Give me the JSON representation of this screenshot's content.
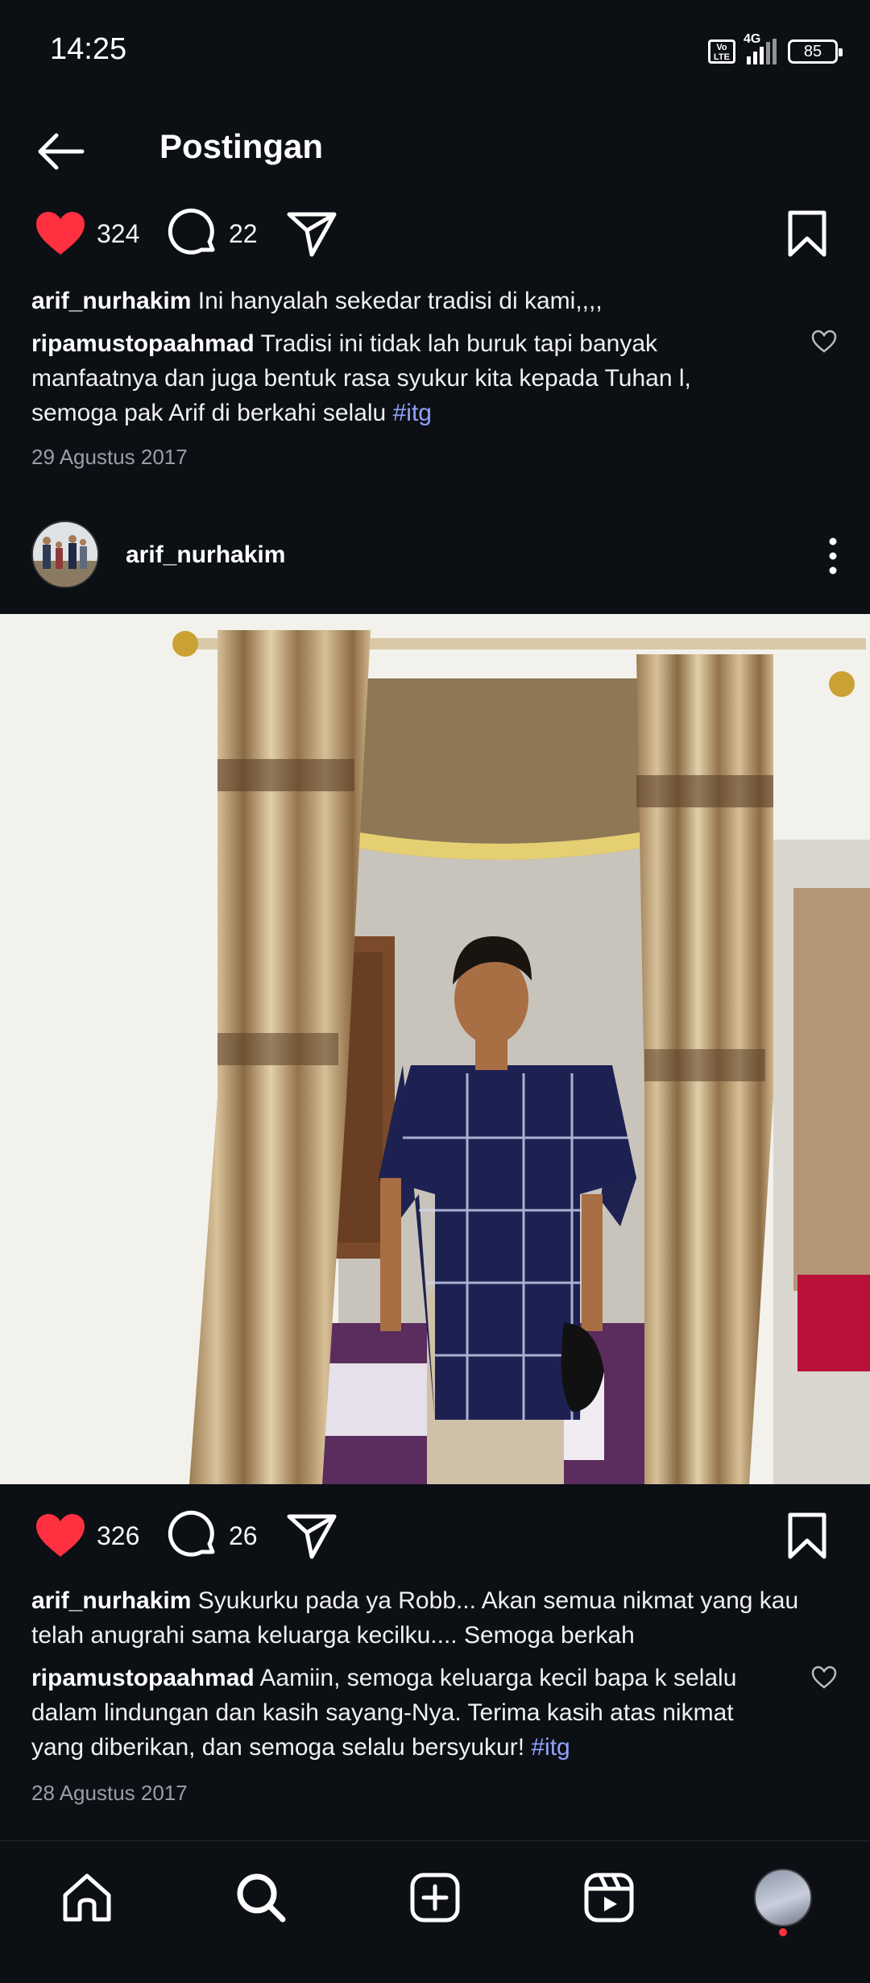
{
  "status_bar": {
    "time": "14:25",
    "volte": "Vo LTE",
    "network": "4G",
    "battery": "85"
  },
  "header": {
    "title": "Postingan"
  },
  "post1": {
    "likes": "324",
    "comments": "22",
    "caption_user": "arif_nurhakim",
    "caption_text": " Ini hanyalah sekedar tradisi di kami,,,,",
    "comment_user": "ripamustopaahmad",
    "comment_text": " Tradisi ini tidak lah buruk tapi banyak manfaatnya dan juga bentuk rasa syukur kita kepada Tuhan l, semoga pak Arif di berkahi selalu ",
    "comment_tag": "#itg",
    "date": "29 Agustus 2017"
  },
  "post2": {
    "username": "arif_nurhakim",
    "likes": "326",
    "comments": "26",
    "caption_user": "arif_nurhakim",
    "caption_text": " Syukurku pada ya Robb... Akan semua nikmat yang kau telah anugrahi sama keluarga kecilku.... Semoga berkah",
    "comment_user": "ripamustopaahmad",
    "comment_text": " Aamiin, semoga keluarga kecil bapa k selalu dalam lindungan dan kasih sayang-Nya. Terima kasih atas nikmat yang diberikan, dan semoga selalu bersyukur! ",
    "comment_tag": "#itg",
    "date": "28 Agustus 2017"
  },
  "icons": {
    "back": "arrow-left-icon",
    "like": "heart-filled-icon",
    "comment": "comment-icon",
    "share": "paper-plane-icon",
    "save": "bookmark-icon",
    "more": "more-vertical-icon",
    "home": "home-icon",
    "search": "search-icon",
    "create": "plus-square-icon",
    "reels": "reels-icon"
  },
  "colors": {
    "background": "#0c0f14",
    "like_red": "#ff3040",
    "hashtag": "#8fa2ff"
  }
}
